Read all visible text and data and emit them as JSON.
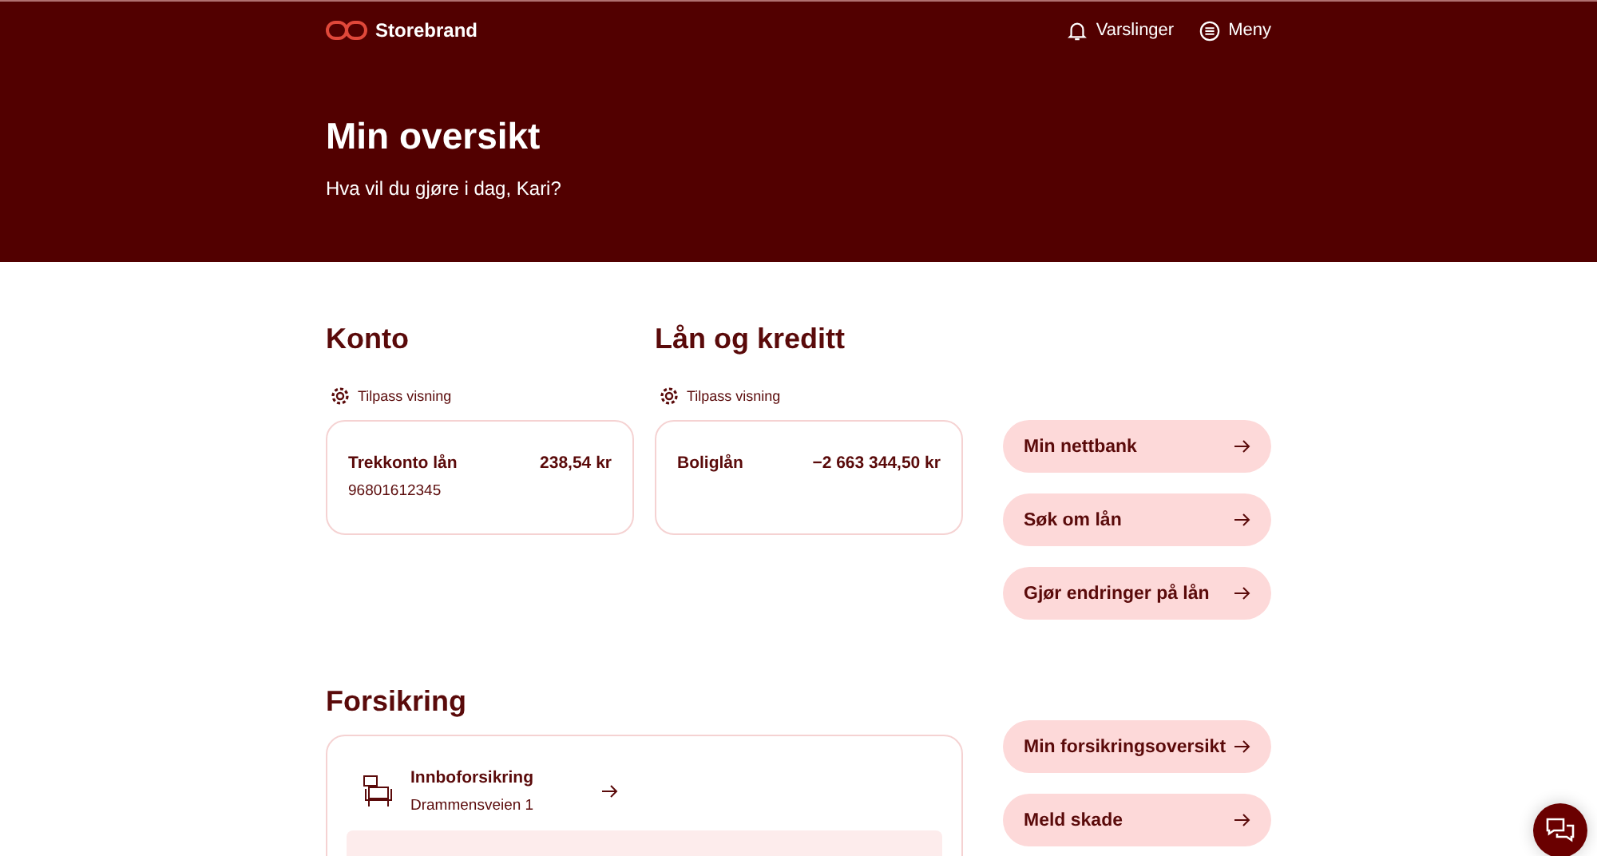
{
  "header": {
    "brand": "Storebrand",
    "nav": [
      {
        "kind": "bell",
        "label": "Varslinger"
      },
      {
        "kind": "menu",
        "label": "Meny"
      }
    ],
    "title": "Min oversikt",
    "greeting": "Hva vil du gjøre i dag, Kari?"
  },
  "accounts": [
    {
      "heading": "Konto",
      "customize": "Tilpass visning",
      "items": [
        {
          "name": "Trekkonto lån",
          "amount": "238,54 kr",
          "number": "96801612345"
        }
      ]
    },
    {
      "heading": "Lån og kreditt",
      "customize": "Tilpass visning",
      "items": [
        {
          "name": "Boliglån",
          "amount": "−2 663 344,50 kr"
        }
      ]
    }
  ],
  "account_actions": [
    "Min nettbank",
    "Søk om lån",
    "Gjør endringer på lån"
  ],
  "insurance": {
    "heading": "Forsikring",
    "items": [
      {
        "name": "Innboforsikring",
        "address": "Drammensveien 1"
      }
    ],
    "actions": [
      "Min forsikringsoversikt",
      "Meld skade"
    ]
  }
}
